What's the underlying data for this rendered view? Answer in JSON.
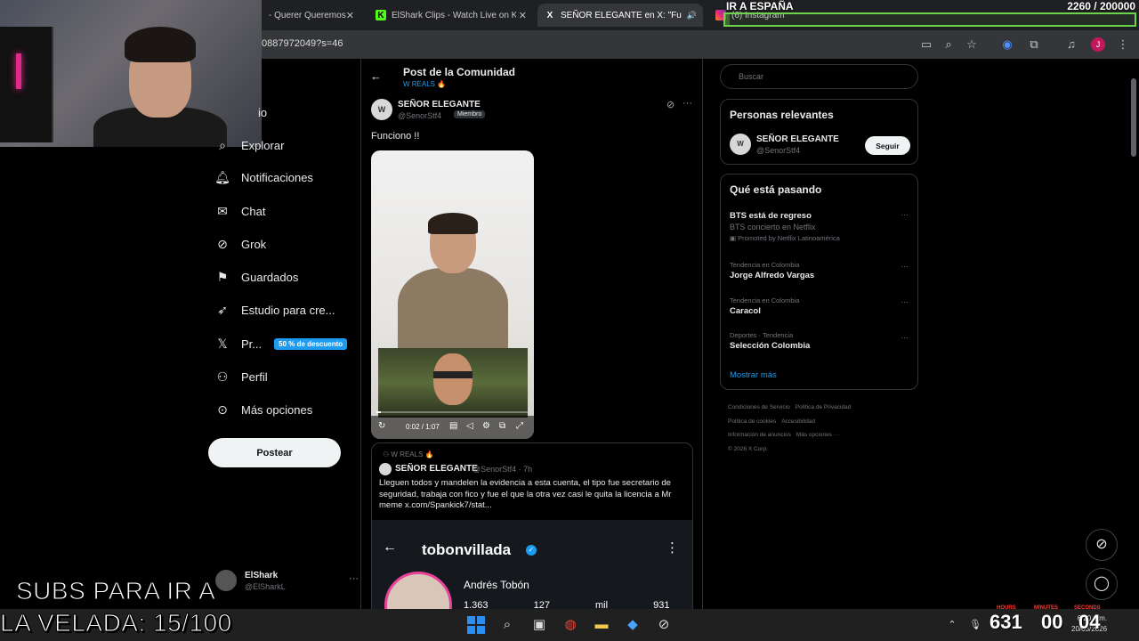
{
  "browser": {
    "tabs": [
      {
        "title": "- Querer Queremos",
        "favicon": "",
        "active": false
      },
      {
        "title": "ElShark Clips - Watch Live on Kick",
        "favicon": "K",
        "active": false
      },
      {
        "title": "SEÑOR ELEGANTE en X: \"Fu",
        "favicon": "X",
        "active": true
      },
      {
        "title": "(6) Instagram",
        "favicon": "ig",
        "active": false
      }
    ],
    "url": "0887972049?s=46",
    "profile_initial": "J"
  },
  "stream": {
    "goal_title": "IR A ESPAÑA",
    "goal_count": "2260 / 200000",
    "goal_progress": 0.0113,
    "subs_line1": "SUBS PARA IR A",
    "subs_line2": "LA VELADA: 15/100",
    "timer": {
      "h_label": "HOURS",
      "m_label": "MINUTES",
      "s_label": "SECONDS",
      "h": "631",
      "m": "00",
      "s": "04"
    }
  },
  "nav": {
    "items": [
      {
        "label": "Explorar",
        "icon": "search-icon"
      },
      {
        "label": "Notificaciones",
        "icon": "bell-icon"
      },
      {
        "label": "Chat",
        "icon": "mail-icon"
      },
      {
        "label": "Grok",
        "icon": "grok-icon"
      },
      {
        "label": "Guardados",
        "icon": "bookmark-icon"
      },
      {
        "label": "Estudio para cre...",
        "icon": "rocket-icon"
      },
      {
        "label": "Pr...",
        "icon": "x-logo-icon"
      },
      {
        "label": "Perfil",
        "icon": "person-icon"
      },
      {
        "label": "Más opciones",
        "icon": "more-icon"
      }
    ],
    "home_partial": "io",
    "promo_badge": "50 % de descuento",
    "post_button": "Postear",
    "account": {
      "name": "ElShark",
      "handle": "@ElSharkL"
    }
  },
  "main": {
    "title": "Post de la Comunidad",
    "subtitle": "W REALS 🔥",
    "post": {
      "avatar": "W",
      "name": "SEÑOR ELEGANTE",
      "handle": "@SenorStf4",
      "badge": "Miembro",
      "text": "Funciono !!",
      "video_time": "0:02 / 1:07",
      "video_progress": 0.03
    },
    "quote": {
      "community": "W REALS 🔥",
      "name": "SEÑOR ELEGANTE",
      "meta": "@SenorStf4 · 7h",
      "text": "Lleguen todos y mandelen la evidencia a esta cuenta, el tipo fue secretario de seguridad, trabaja con fico y fue el que la otra vez casi le quita la licencia a Mr meme  x.com/Spankick7/stat...",
      "shot_user": "tobonvillada",
      "shot_fullname": "Andrés Tobón",
      "shot_stats": "1.363 127 mil 931"
    }
  },
  "right": {
    "search_placeholder": "Buscar",
    "relevant": {
      "title": "Personas relevantes",
      "avatar": "W",
      "name": "SEÑOR ELEGANTE",
      "handle": "@SenorStf4",
      "follow": "Seguir"
    },
    "trending": {
      "title": "Qué está pasando",
      "items": [
        {
          "context": "",
          "title": "BTS está de regreso",
          "sub": "BTS concierto en Netflix",
          "promo": "Promoted by Netflix Latinoamérica"
        },
        {
          "context": "Tendencia en Colombia",
          "title": "Jorge Alfredo Vargas",
          "sub": "",
          "promo": ""
        },
        {
          "context": "Tendencia en Colombia",
          "title": "Caracol",
          "sub": "",
          "promo": ""
        },
        {
          "context": "Deportes · Tendencia",
          "title": "Selección Colombia",
          "sub": "",
          "promo": ""
        }
      ],
      "show_more": "Mostrar más"
    },
    "footer": [
      "Condiciones de Servicio",
      "Política de Privacidad",
      "Política de cookies",
      "Accesibilidad",
      "Información de anuncios",
      "Más opciones ···",
      "© 2026 X Corp."
    ]
  },
  "taskbar": {
    "time": "6:20 p.m.",
    "date": "20/03/2026"
  }
}
